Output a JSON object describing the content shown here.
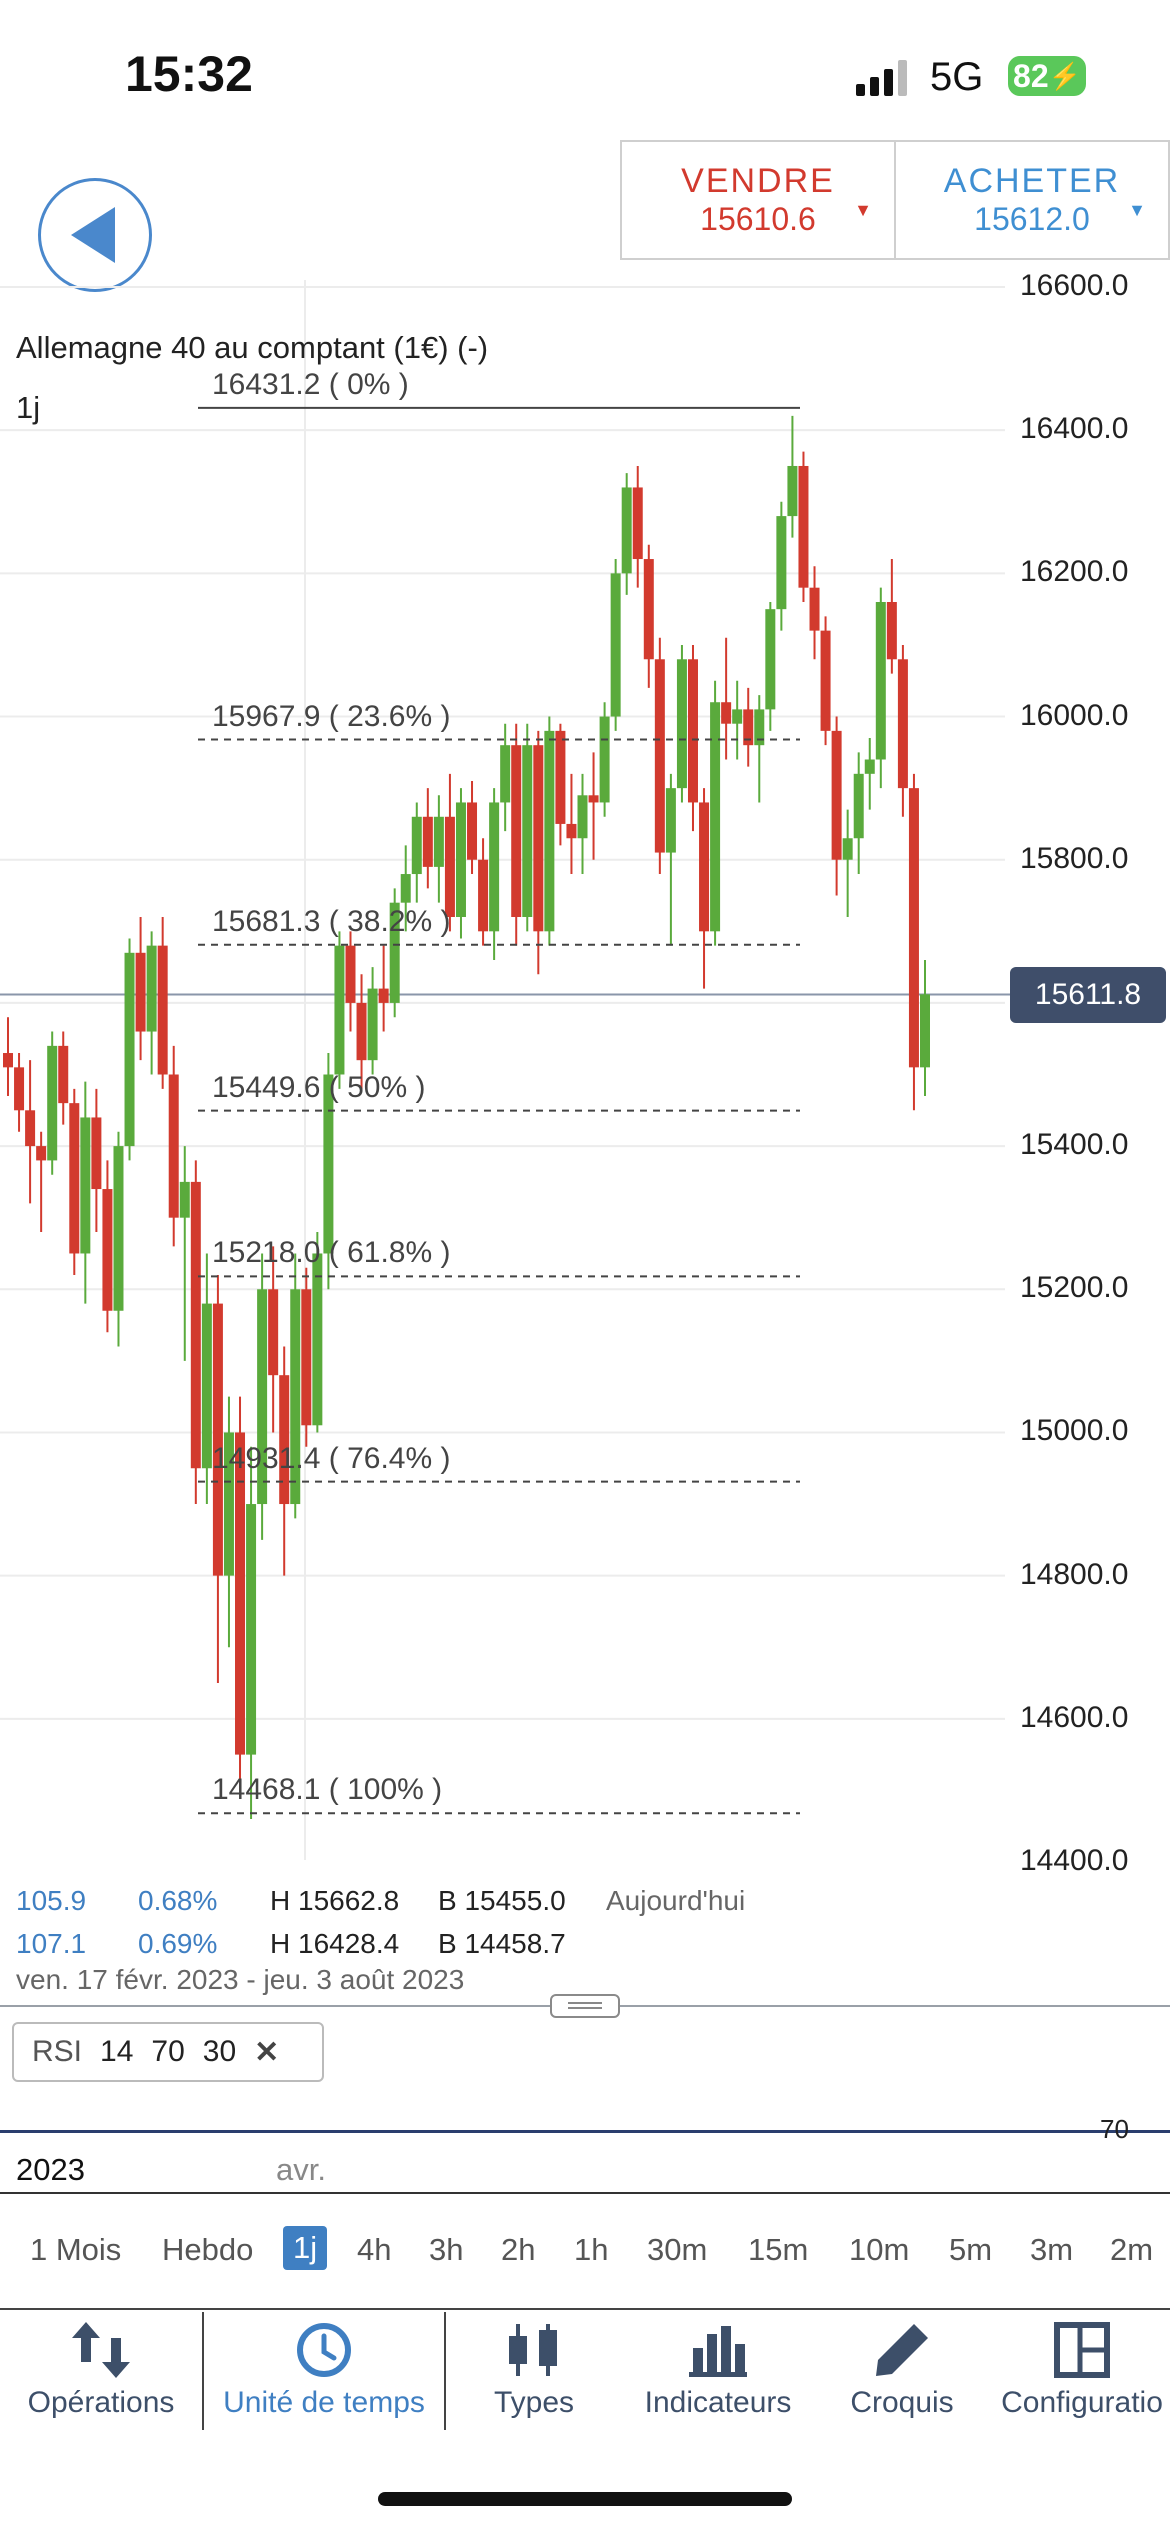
{
  "status_bar": {
    "time": "15:32",
    "network": "5G",
    "battery": "82"
  },
  "trade": {
    "sell_label": "VENDRE",
    "sell_price": "15610.6",
    "buy_label": "ACHETER",
    "buy_price": "15612.0",
    "sell_color": "#d23a2e",
    "buy_color": "#3f8fd2"
  },
  "chart_title": "Allemagne 40 au comptant (1€) (-)",
  "chart_period": "1j",
  "current_price": "15611.8",
  "chart_data": {
    "type": "candlestick",
    "y_ticks": [
      "16600.0",
      "16400.0",
      "16200.0",
      "16000.0",
      "15800.0",
      "15600.0",
      "15400.0",
      "15200.0",
      "15000.0",
      "14800.0",
      "14600.0",
      "14400.0"
    ],
    "ylim": [
      14350,
      16650
    ],
    "up_color": "#5aaa3c",
    "down_color": "#d23a2e",
    "fib_levels": [
      {
        "value": 16431.2,
        "label": "16431.2 ( 0% )"
      },
      {
        "value": 15967.9,
        "label": "15967.9 ( 23.6% )"
      },
      {
        "value": 15681.3,
        "label": "15681.3 ( 38.2% )"
      },
      {
        "value": 15449.6,
        "label": "15449.6 ( 50% )"
      },
      {
        "value": 15218.0,
        "label": "15218.0 ( 61.8% )"
      },
      {
        "value": 14931.4,
        "label": "14931.4 ( 76.4% )"
      },
      {
        "value": 14468.1,
        "label": "14468.1 ( 100% )"
      }
    ],
    "candles": [
      [
        15530,
        15580,
        15470,
        15510
      ],
      [
        15510,
        15530,
        15420,
        15450
      ],
      [
        15450,
        15520,
        15320,
        15400
      ],
      [
        15400,
        15420,
        15280,
        15380
      ],
      [
        15380,
        15560,
        15360,
        15540
      ],
      [
        15540,
        15560,
        15430,
        15460
      ],
      [
        15460,
        15480,
        15220,
        15250
      ],
      [
        15250,
        15490,
        15180,
        15440
      ],
      [
        15440,
        15480,
        15280,
        15340
      ],
      [
        15340,
        15380,
        15140,
        15170
      ],
      [
        15170,
        15420,
        15120,
        15400
      ],
      [
        15400,
        15690,
        15380,
        15670
      ],
      [
        15670,
        15720,
        15520,
        15560
      ],
      [
        15560,
        15700,
        15500,
        15680
      ],
      [
        15680,
        15720,
        15480,
        15500
      ],
      [
        15500,
        15540,
        15260,
        15300
      ],
      [
        15300,
        15400,
        15100,
        15350
      ],
      [
        15350,
        15380,
        14900,
        14950
      ],
      [
        14950,
        15250,
        14900,
        15180
      ],
      [
        15180,
        15220,
        14650,
        14800
      ],
      [
        14800,
        15050,
        14700,
        15000
      ],
      [
        15000,
        15050,
        14500,
        14550
      ],
      [
        14550,
        14980,
        14460,
        14900
      ],
      [
        14900,
        15250,
        14850,
        15200
      ],
      [
        15200,
        15260,
        15000,
        15080
      ],
      [
        15080,
        15120,
        14800,
        14900
      ],
      [
        14900,
        15250,
        14880,
        15200
      ],
      [
        15200,
        15230,
        14980,
        15010
      ],
      [
        15010,
        15280,
        15000,
        15250
      ],
      [
        15250,
        15530,
        15200,
        15500
      ],
      [
        15500,
        15700,
        15480,
        15680
      ],
      [
        15680,
        15700,
        15560,
        15600
      ],
      [
        15600,
        15640,
        15480,
        15520
      ],
      [
        15520,
        15650,
        15500,
        15620
      ],
      [
        15620,
        15680,
        15560,
        15600
      ],
      [
        15600,
        15760,
        15580,
        15740
      ],
      [
        15740,
        15820,
        15700,
        15780
      ],
      [
        15780,
        15880,
        15740,
        15860
      ],
      [
        15860,
        15900,
        15760,
        15790
      ],
      [
        15790,
        15890,
        15740,
        15860
      ],
      [
        15860,
        15920,
        15700,
        15720
      ],
      [
        15720,
        15900,
        15690,
        15880
      ],
      [
        15880,
        15910,
        15780,
        15800
      ],
      [
        15800,
        15830,
        15680,
        15700
      ],
      [
        15700,
        15900,
        15660,
        15880
      ],
      [
        15880,
        15990,
        15840,
        15960
      ],
      [
        15960,
        15990,
        15680,
        15720
      ],
      [
        15720,
        15990,
        15700,
        15960
      ],
      [
        15960,
        15980,
        15640,
        15700
      ],
      [
        15700,
        16000,
        15680,
        15980
      ],
      [
        15980,
        15990,
        15820,
        15850
      ],
      [
        15850,
        15920,
        15780,
        15830
      ],
      [
        15830,
        15920,
        15780,
        15890
      ],
      [
        15890,
        15950,
        15800,
        15880
      ],
      [
        15880,
        16020,
        15860,
        16000
      ],
      [
        16000,
        16220,
        15980,
        16200
      ],
      [
        16200,
        16340,
        16170,
        16320
      ],
      [
        16320,
        16350,
        16180,
        16220
      ],
      [
        16220,
        16240,
        16040,
        16080
      ],
      [
        16080,
        16110,
        15780,
        15810
      ],
      [
        15810,
        15920,
        15680,
        15900
      ],
      [
        15900,
        16100,
        15880,
        16080
      ],
      [
        16080,
        16100,
        15840,
        15880
      ],
      [
        15880,
        15900,
        15620,
        15700
      ],
      [
        15700,
        16050,
        15680,
        16020
      ],
      [
        16020,
        16110,
        15940,
        15990
      ],
      [
        15990,
        16050,
        15940,
        16010
      ],
      [
        16010,
        16040,
        15930,
        15960
      ],
      [
        15960,
        16030,
        15880,
        16010
      ],
      [
        16010,
        16160,
        15980,
        16150
      ],
      [
        16150,
        16300,
        16120,
        16280
      ],
      [
        16280,
        16420,
        16250,
        16350
      ],
      [
        16350,
        16370,
        16160,
        16180
      ],
      [
        16180,
        16210,
        16080,
        16120
      ],
      [
        16120,
        16140,
        15960,
        15980
      ],
      [
        15980,
        16000,
        15750,
        15800
      ],
      [
        15800,
        15870,
        15720,
        15830
      ],
      [
        15830,
        15950,
        15780,
        15920
      ],
      [
        15920,
        15970,
        15870,
        15940
      ],
      [
        15940,
        16180,
        15900,
        16160
      ],
      [
        16160,
        16220,
        16060,
        16080
      ],
      [
        16080,
        16100,
        15860,
        15900
      ],
      [
        15900,
        15920,
        15450,
        15510
      ],
      [
        15510,
        15660,
        15470,
        15612
      ]
    ]
  },
  "stats": {
    "row1": {
      "value": "105.9",
      "pct": "0.68%",
      "high": "H 15662.8",
      "low": "B 15455.0",
      "tag": "Aujourd'hui"
    },
    "row2": {
      "value": "107.1",
      "pct": "0.69%",
      "high": "H 16428.4",
      "low": "B 14458.7"
    },
    "range": "ven. 17 févr. 2023 - jeu. 3 août 2023"
  },
  "rsi": {
    "label": "RSI",
    "p1": "14",
    "p2": "70",
    "p3": "30",
    "close": "✕",
    "level": "70"
  },
  "time_axis": {
    "year": "2023",
    "month": "avr."
  },
  "timeframes": [
    "1 Mois",
    "Hebdo",
    "1j",
    "4h",
    "3h",
    "2h",
    "1h",
    "30m",
    "15m",
    "10m",
    "5m",
    "3m",
    "2m"
  ],
  "tabs": [
    {
      "label": "Opérations",
      "icon": "swap-arrows-icon"
    },
    {
      "label": "Unité de temps",
      "icon": "clock-icon"
    },
    {
      "label": "Types",
      "icon": "candlestick-icon"
    },
    {
      "label": "Indicateurs",
      "icon": "bar-chart-icon"
    },
    {
      "label": "Croquis",
      "icon": "pencil-icon"
    },
    {
      "label": "Configuratio",
      "icon": "layout-icon"
    }
  ]
}
